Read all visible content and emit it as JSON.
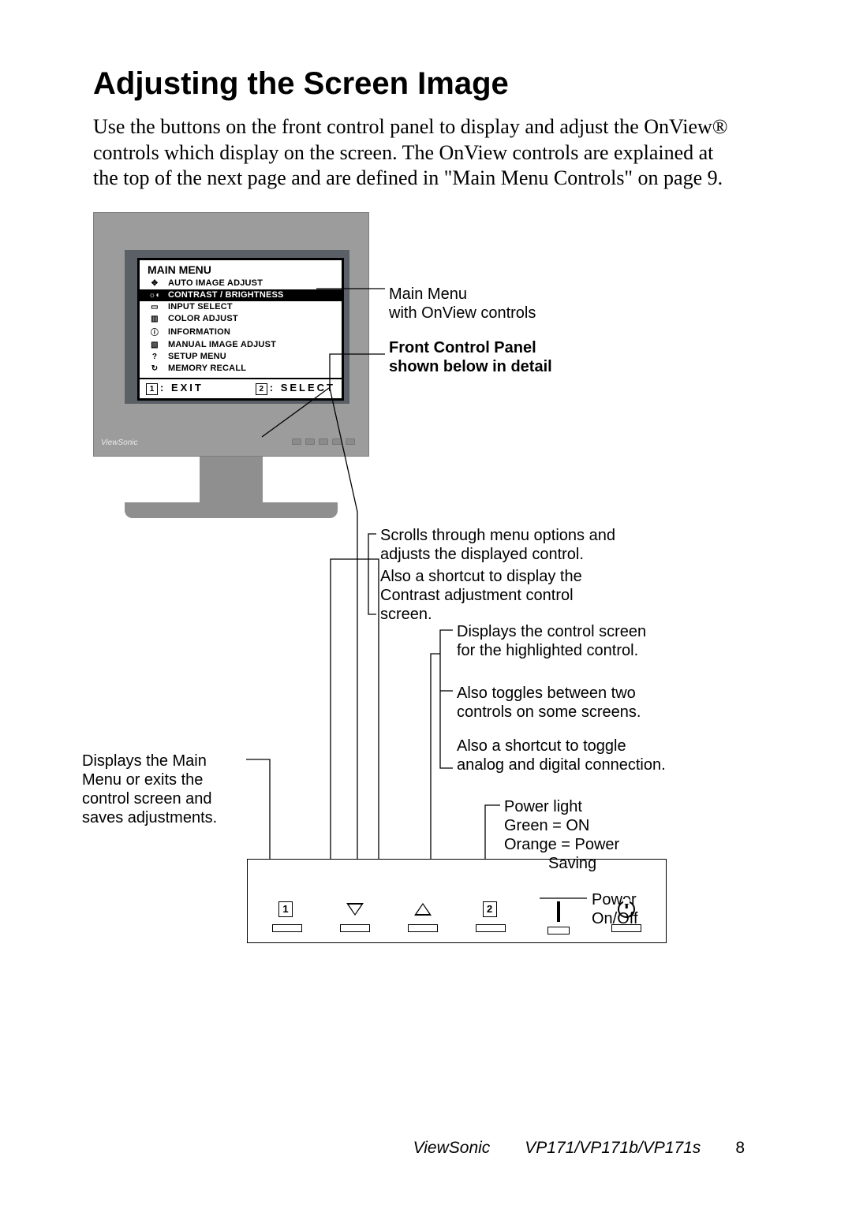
{
  "title": "Adjusting the Screen Image",
  "intro": "Use the buttons on the front control panel to display and adjust the OnView® controls which display on the screen. The OnView controls are explained at the top of the next page and are defined in \"Main Menu Controls\" on page 9.",
  "monitor_brand": "ViewSonic",
  "osd": {
    "title": "MAIN MENU",
    "items": [
      {
        "label": "AUTO IMAGE ADJUST",
        "icon": "✥"
      },
      {
        "label": "CONTRAST / BRIGHTNESS",
        "icon": "☼◐",
        "selected": true
      },
      {
        "label": "INPUT SELECT",
        "icon": "▭"
      },
      {
        "label": "COLOR ADJUST",
        "icon": "▥"
      },
      {
        "label": "INFORMATION",
        "icon": "ⓘ"
      },
      {
        "label": "MANUAL IMAGE ADJUST",
        "icon": "▧"
      },
      {
        "label": "SETUP MENU",
        "icon": "?"
      },
      {
        "label": "MEMORY RECALL",
        "icon": "↻"
      }
    ],
    "footer_left_key": "1",
    "footer_left_label": ": EXIT",
    "footer_right_key": "2",
    "footer_right_label": ": SELECT"
  },
  "callouts": {
    "main_menu_1": "Main Menu",
    "main_menu_2": "with OnView controls",
    "front_panel_1": "Front Control Panel",
    "front_panel_2": "shown below in detail",
    "scroll_1": "Scrolls through menu options and adjusts the displayed control.",
    "scroll_2": "Also a shortcut to display the Contrast adjustment control screen.",
    "select_1": "Displays the control screen for the highlighted control.",
    "select_2": "Also toggles between two controls on some screens.",
    "select_3": "Also a shortcut to toggle analog and digital connection.",
    "exit_1": "Displays the Main Menu or exits the control screen and saves adjustments.",
    "powerlight_1": "Power light",
    "powerlight_2": "Green = ON",
    "powerlight_3": "Orange = Power",
    "powerlight_4": "Saving",
    "power_onoff_1": "Power",
    "power_onoff_2": "On/Off"
  },
  "panel_keys": [
    "1",
    "down",
    "up",
    "2",
    "led",
    "power"
  ],
  "footer": {
    "brand": "ViewSonic",
    "model": "VP171/VP171b/VP171s",
    "page": "8"
  }
}
